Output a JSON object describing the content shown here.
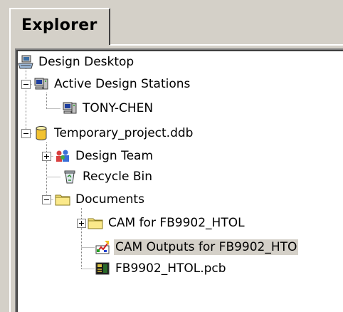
{
  "explorer": {
    "tab_label": "Explorer"
  },
  "tree": {
    "root": {
      "label": "Design Desktop",
      "icon": "desktop-icon"
    },
    "stations": {
      "label": "Active Design Stations",
      "icon": "computer-icon",
      "state": "expanded"
    },
    "station_1": {
      "label": "TONY-CHEN",
      "icon": "computer-icon"
    },
    "project": {
      "label": "Temporary_project.ddb",
      "icon": "database-icon",
      "state": "expanded"
    },
    "design_team": {
      "label": "Design Team",
      "icon": "team-icon",
      "state": "collapsed"
    },
    "recycle_bin": {
      "label": "Recycle Bin",
      "icon": "recycle-bin-icon"
    },
    "documents": {
      "label": "Documents",
      "icon": "folder-icon",
      "state": "expanded"
    },
    "cam_folder": {
      "label": "CAM for FB9902_HTOL",
      "icon": "folder-icon",
      "state": "collapsed"
    },
    "cam_outputs": {
      "label": "CAM Outputs for FB9902_HTO",
      "icon": "cam-icon",
      "selected": true
    },
    "pcb": {
      "label": "FB9902_HTOL.pcb",
      "icon": "pcb-icon"
    }
  },
  "colors": {
    "panel": "#d4d0c8",
    "tree_bg": "#ffffff",
    "selection": "#d4d0c8",
    "folder": "#f5e27a"
  }
}
